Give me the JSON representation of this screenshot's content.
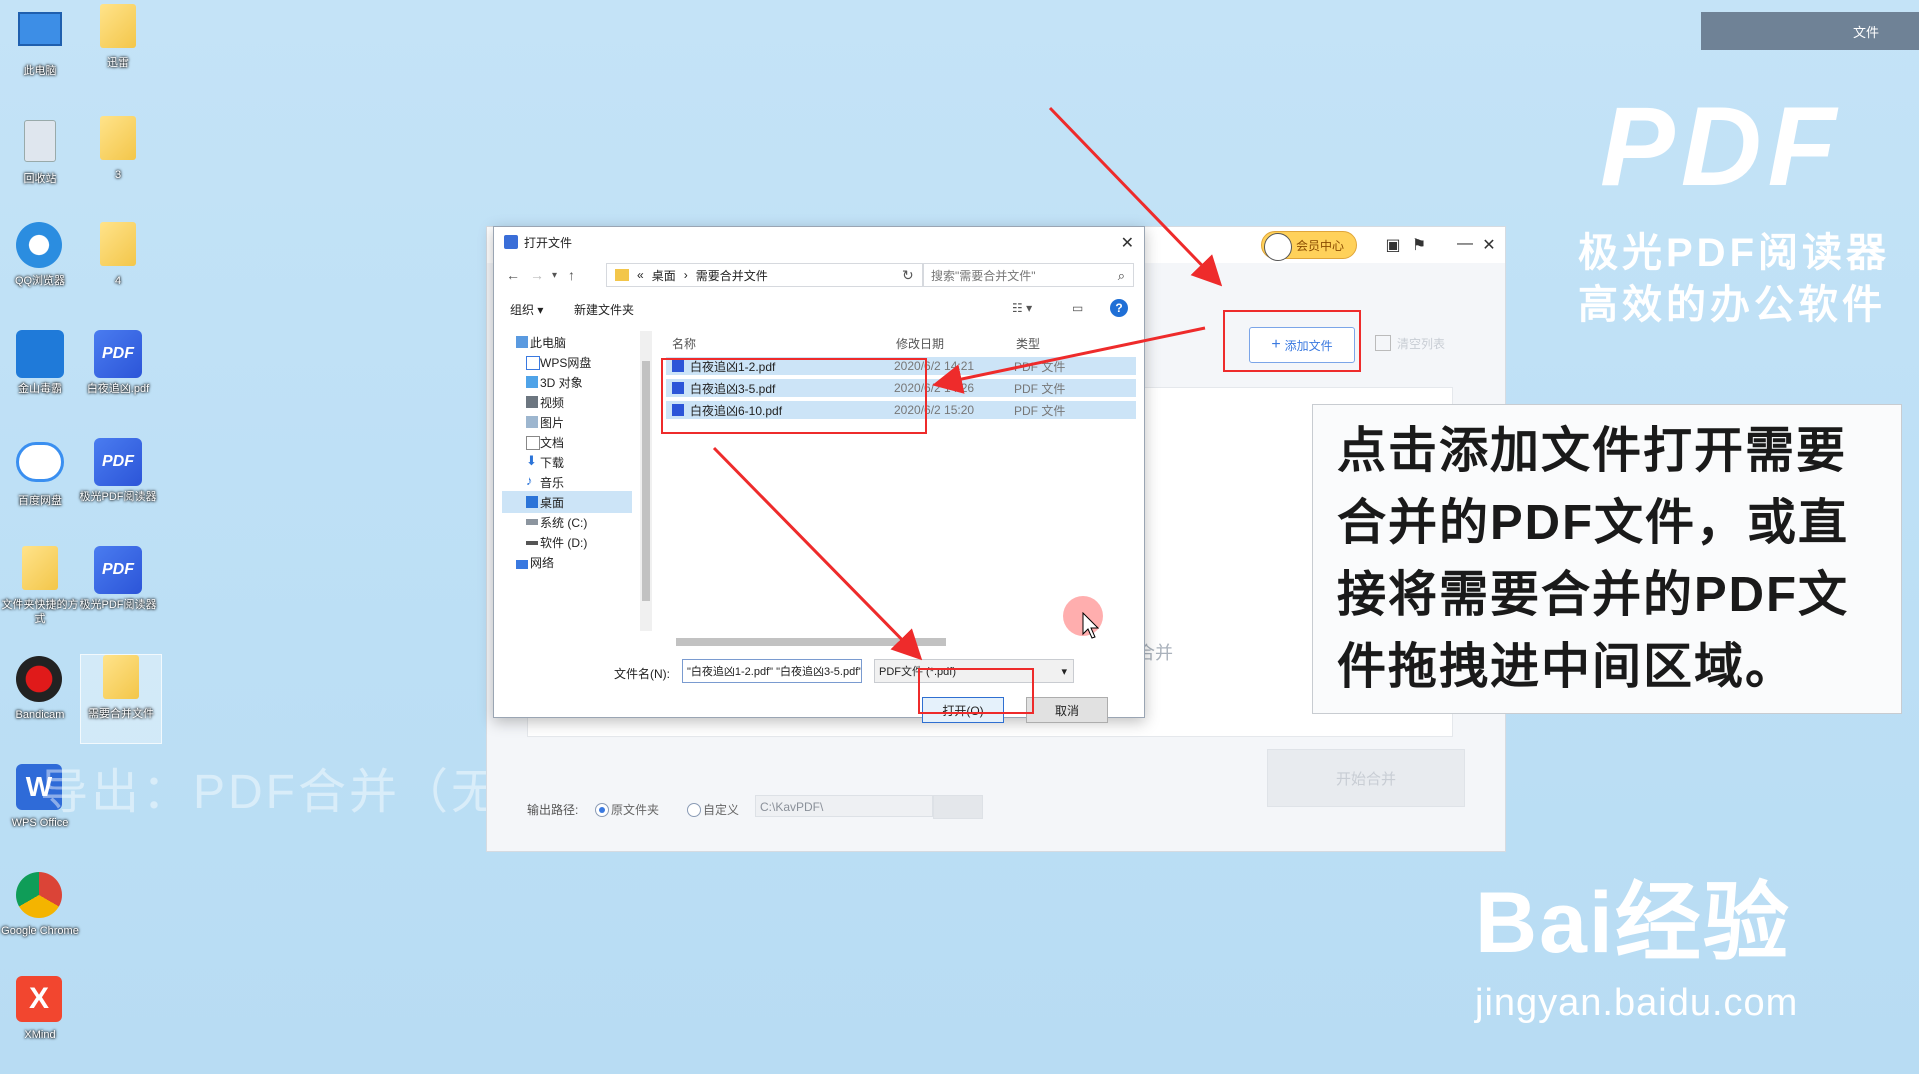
{
  "desktop_icons": [
    {
      "name": "此电脑"
    },
    {
      "name": "迅雷"
    },
    {
      "name": "回收站"
    },
    {
      "name": "3"
    },
    {
      "name": "QQ浏览器"
    },
    {
      "name": "4"
    },
    {
      "name": "金山毒霸"
    },
    {
      "name": "白夜追凶.pdf"
    },
    {
      "name": "百度网盘"
    },
    {
      "name": "极光PDF阅读器"
    },
    {
      "name": "文件夹快捷的方式"
    },
    {
      "name": "极光PDF阅读器"
    },
    {
      "name": "Bandicam"
    },
    {
      "name": "需要合并文件"
    },
    {
      "name": "WPS Office"
    },
    {
      "name": "Google Chrome"
    },
    {
      "name": "XMind"
    }
  ],
  "top_right_bar": {
    "label": "文件"
  },
  "brand": {
    "logo": "PDF",
    "line1": "极光PDF阅读器",
    "line2": "高效的办公软件"
  },
  "app_window": {
    "member_label": "会员中心",
    "add_file_label": "添加文件",
    "clear_label": "清空列表",
    "merge_hint": "合并",
    "output_path_label": "输出路径:",
    "radio_source": "原文件夹",
    "radio_custom": "自定义",
    "path_value": "C:\\KavPDF\\",
    "start_label": "开始合并"
  },
  "dialog": {
    "title": "打开文件",
    "breadcrumb": [
      "桌面",
      "需要合并文件"
    ],
    "search_placeholder": "搜索\"需要合并文件\"",
    "organize": "组织 ▾",
    "new_folder": "新建文件夹",
    "sidebar": [
      "此电脑",
      "WPS网盘",
      "3D 对象",
      "视频",
      "图片",
      "文档",
      "下载",
      "音乐",
      "桌面",
      "系统 (C:)",
      "软件 (D:)",
      "网络"
    ],
    "columns": {
      "name": "名称",
      "date": "修改日期",
      "type": "类型"
    },
    "files": [
      {
        "name": "白夜追凶1-2.pdf",
        "date": "2020/6/2 14:21",
        "type": "PDF 文件"
      },
      {
        "name": "白夜追凶3-5.pdf",
        "date": "2020/6/2 14:26",
        "type": "PDF 文件"
      },
      {
        "name": "白夜追凶6-10.pdf",
        "date": "2020/6/2 15:20",
        "type": "PDF 文件"
      }
    ],
    "filename_label": "文件名(N):",
    "filename_value": "\"白夜追凶1-2.pdf\" \"白夜追凶3-5.pdf\" \"白夜追凶6-10.pdf\"",
    "filetype_value": "PDF文件 (*.pdf)",
    "open_label": "打开(O)",
    "cancel_label": "取消"
  },
  "tutorial_text": "点击添加文件打开需要合并的PDF文件，或直接将需要合并的PDF文件拖拽进中间区域。",
  "ghost_text": "导出：PDF合并（无",
  "watermark": {
    "main": "Bai经验",
    "sub": "jingyan.baidu.com"
  },
  "colors": {
    "accent": "#3a79e0",
    "annotation_red": "#ee2b2b",
    "selection": "#cce4f7"
  }
}
